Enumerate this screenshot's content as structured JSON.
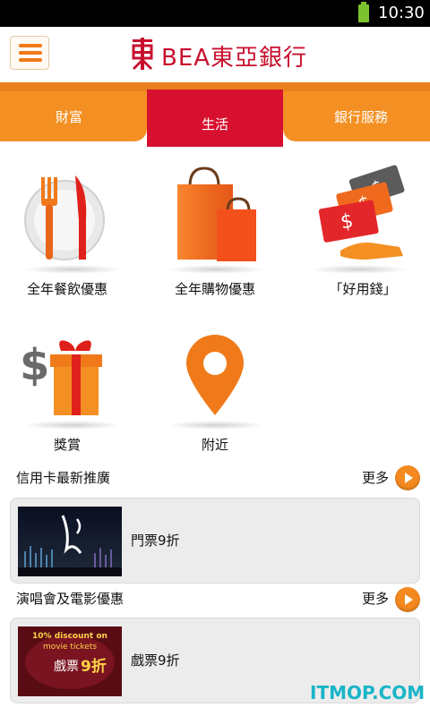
{
  "status_bar": {
    "time": "10:30"
  },
  "header": {
    "logo_text": "BEA東亞銀行"
  },
  "tabs": [
    {
      "label": "財富"
    },
    {
      "label": "生活"
    },
    {
      "label": "銀行服務"
    }
  ],
  "categories": [
    {
      "label": "全年餐飲優惠",
      "icon": "dining-icon"
    },
    {
      "label": "全年購物優惠",
      "icon": "shopping-bags-icon"
    },
    {
      "label": "「好用錢」",
      "icon": "cash-cards-icon"
    },
    {
      "label": "獎賞",
      "icon": "gift-icon"
    },
    {
      "label": "附近",
      "icon": "location-pin-icon"
    }
  ],
  "sections": [
    {
      "title": "信用卡最新推廣",
      "more": "更多",
      "card": {
        "text": "門票9折"
      }
    },
    {
      "title": "演唱會及電影優惠",
      "more": "更多",
      "card": {
        "text": "戲票9折",
        "thumb_line1": "10% discount on",
        "thumb_line2": "movie tickets",
        "thumb_line3": "戲票",
        "thumb_line4": "9折"
      }
    }
  ],
  "watermark": "ITMOP.COM",
  "colors": {
    "accent_orange": "#f49023",
    "brand_red": "#d8102f"
  }
}
